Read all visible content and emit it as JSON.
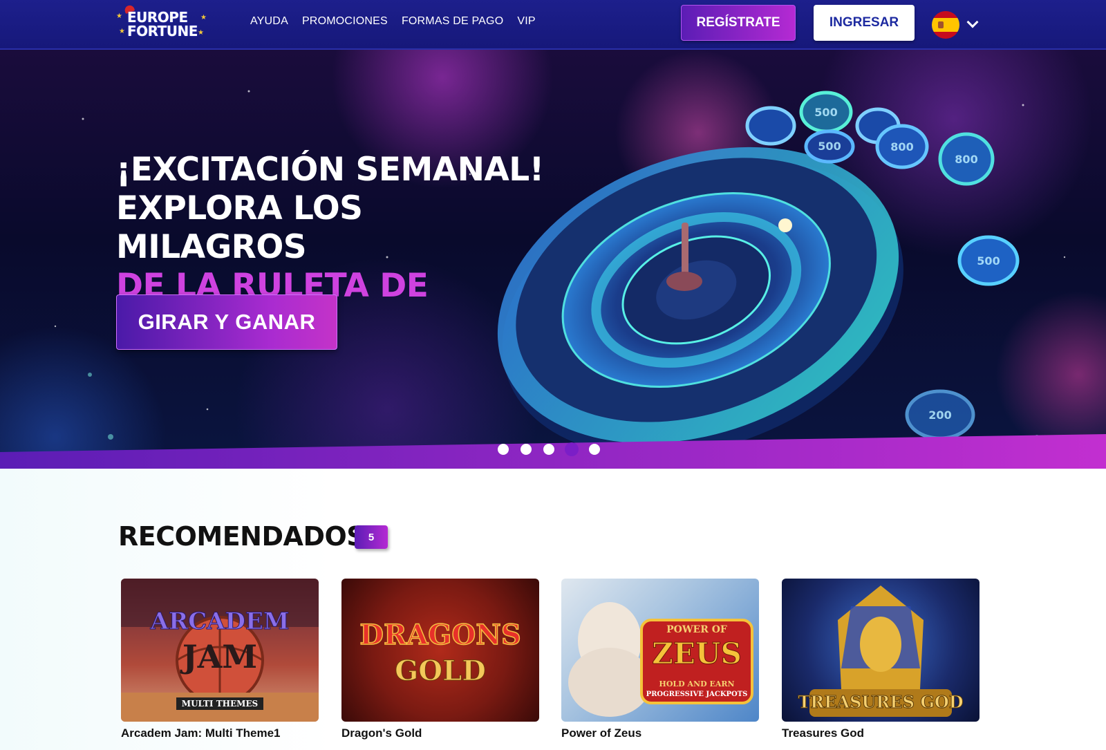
{
  "brand": {
    "name": "EUROPE FORTUNE",
    "line1": "EUROPE",
    "line2": "FORTUNE"
  },
  "nav": {
    "items": [
      "AYUDA",
      "PROMOCIONES",
      "FORMAS DE PAGO",
      "VIP"
    ]
  },
  "header": {
    "register_label": "REGÍSTRATE",
    "login_label": "INGRESAR",
    "language_icon": "spain-flag-icon"
  },
  "hero": {
    "line1": "¡EXCITACIÓN SEMANAL!",
    "line2": "EXPLORA LOS MILAGROS",
    "line3": "DE LA RULETA DE BONO",
    "cta_label": "GIRAR Y GANAR",
    "slides_total": 5,
    "active_slide": 4
  },
  "recommended": {
    "title": "RECOMENDADOS",
    "count": "5",
    "games": [
      {
        "name": "Arcadem Jam: Multi Theme1",
        "art_line1": "ARCADEM",
        "art_line2": "JAM",
        "art_tag": "MULTI THEMES"
      },
      {
        "name": "Dragon's Gold",
        "art_line1": "DRAGONS",
        "art_line2": "GOLD"
      },
      {
        "name": "Power of Zeus",
        "art_line1": "POWER OF",
        "art_line2": "ZEUS",
        "art_tag1": "HOLD AND EARN",
        "art_tag2": "PROGRESSIVE JACKPOTS"
      },
      {
        "name": "Treasures God",
        "art_line1": "TREASURES GOD"
      }
    ]
  },
  "colors": {
    "header_bg": "#1d1f8c",
    "accent_purple": "#b52ad3",
    "hero_accent": "#cf42e0",
    "login_text": "#1d2aa0"
  }
}
